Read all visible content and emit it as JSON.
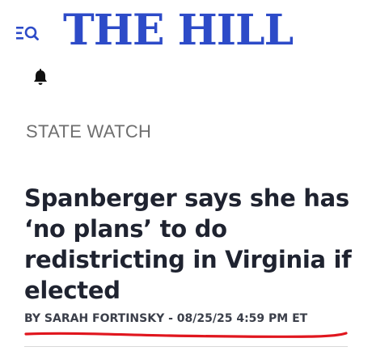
{
  "header": {
    "logo_text": "THE HILL",
    "menu_icon": "menu-search-icon",
    "bell_icon": "bell-icon",
    "brand_color": "#2d4bc8"
  },
  "section": {
    "label": "STATE WATCH"
  },
  "article": {
    "headline": "Spanberger says she has ‘no plans’ to do redistricting in Virginia if elected",
    "byline": {
      "prefix": "BY",
      "author": "SARAH FORTINSKY",
      "separator": "-",
      "datetime": "08/25/25 4:59 PM ET"
    }
  },
  "annotation": {
    "underline_color": "#e0161e"
  }
}
